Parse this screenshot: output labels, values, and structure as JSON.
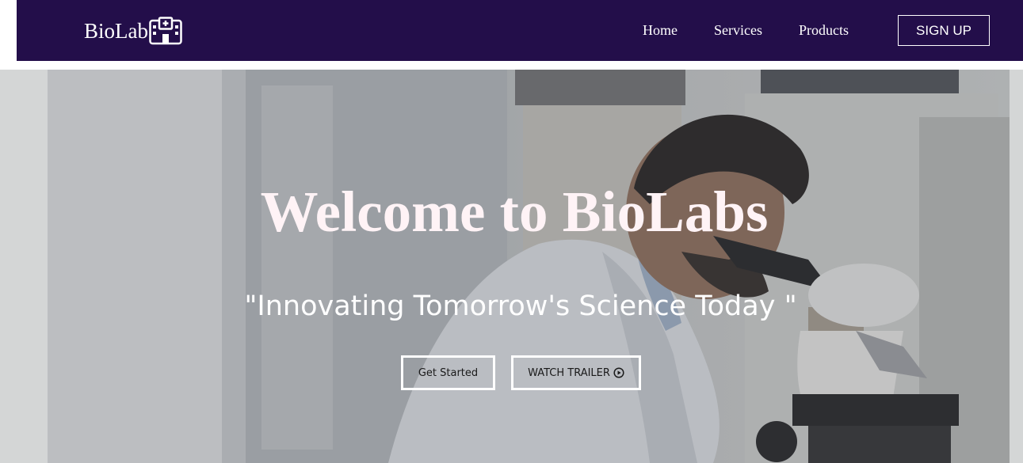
{
  "nav": {
    "brand_text": "BioLab",
    "brand_icon": "hospital-icon",
    "links": [
      {
        "label": "Home"
      },
      {
        "label": "Services"
      },
      {
        "label": "Products"
      }
    ],
    "signup_label": "SIGN UP",
    "background_color": "#230e4a"
  },
  "hero": {
    "title": "Welcome to BioLabs",
    "tagline": "\"Innovating Tomorrow's Science Today \"",
    "buttons": {
      "get_started": "Get Started",
      "watch_trailer": "WATCH TRAILER"
    },
    "play_icon": "play-circle-icon",
    "title_color": "#fff3f6"
  }
}
